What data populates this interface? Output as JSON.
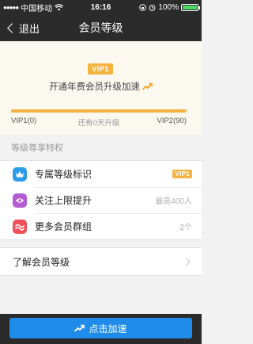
{
  "status_bar": {
    "carrier": "中国移动",
    "time": "16:16",
    "battery": "100%",
    "battery_level": 1.0
  },
  "nav": {
    "back_label": "退出",
    "title": "会员等级"
  },
  "hero": {
    "badge": "VIP1",
    "message": "开通年费会员升级加速",
    "progress": 1.0,
    "left_label": "VIP1(0)",
    "middle_label": "还有0天升级",
    "right_label": "VIP2(90)"
  },
  "privileges": {
    "header": "等级尊享特权",
    "items": [
      {
        "label": "专属等级标识",
        "value": "VIP1",
        "icon": "crown-icon",
        "color": "#2d9be8"
      },
      {
        "label": "关注上限提升",
        "value": "最高400人",
        "icon": "follow-eye-icon",
        "color": "#b45bd6"
      },
      {
        "label": "更多会员群组",
        "value": "2个",
        "icon": "group-wave-icon",
        "color": "#f0505a"
      }
    ]
  },
  "learn_more": {
    "label": "了解会员等级"
  },
  "bottom": {
    "button_label": "点击加速"
  },
  "colors": {
    "accent": "#f4b340",
    "button": "#1f8cea",
    "bar": "#2b2b2b"
  }
}
